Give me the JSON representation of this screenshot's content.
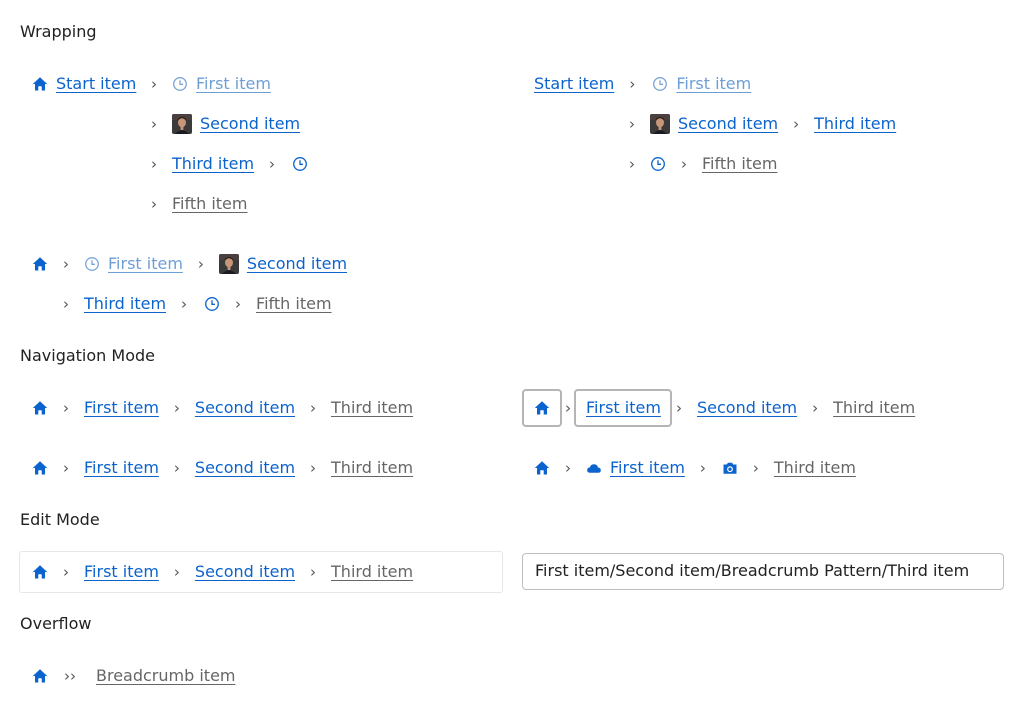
{
  "sections": {
    "wrapping": "Wrapping",
    "navigation": "Navigation Mode",
    "edit": "Edit Mode",
    "overflow": "Overflow"
  },
  "items": {
    "start": "Start item",
    "first": "First item",
    "second": "Second item",
    "third": "Third item",
    "fifth": "Fifth item",
    "breadcrumb": "Breadcrumb item"
  },
  "edit_mode": {
    "path_value": "First item/Second item/Breadcrumb Pattern/Third item"
  },
  "icons": {
    "home": "home-icon",
    "recent": "clock-icon",
    "avatar": "avatar-thumbnail",
    "cloud": "cloud-icon",
    "camera": "camera-icon",
    "separator": "chevron-right-icon",
    "overflow": "double-chevron-right-icon"
  },
  "colors": {
    "link": "#0b63ce",
    "link_dimmed": "#6d9fd6",
    "current": "#666666",
    "focus_outline": "#b5b5b5"
  }
}
